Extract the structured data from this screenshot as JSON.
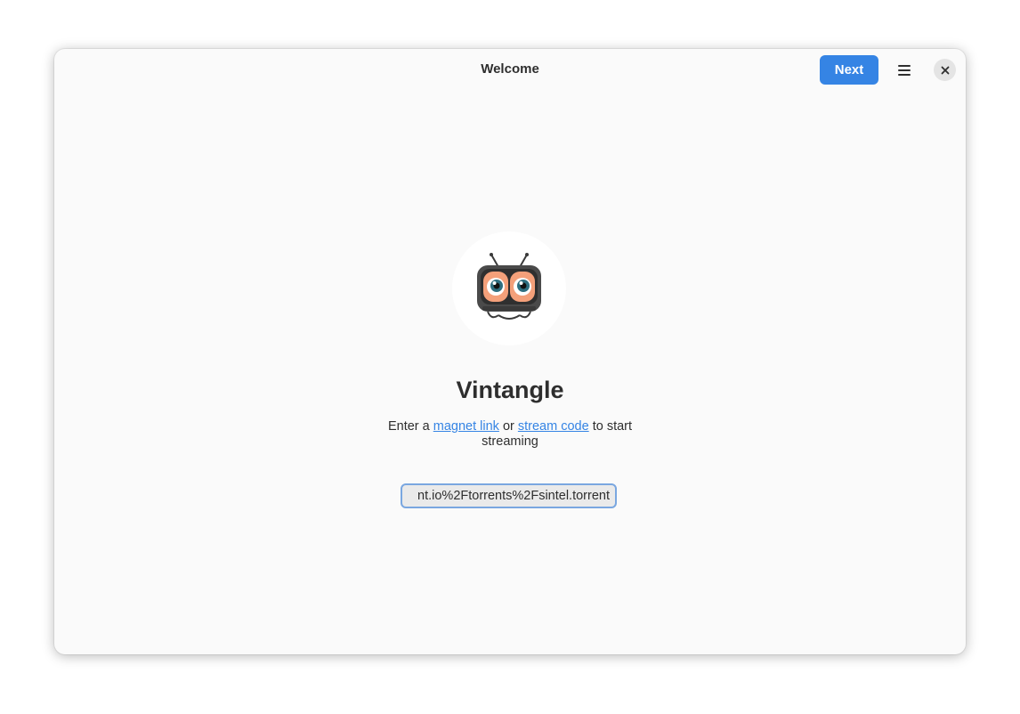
{
  "window": {
    "title": "Welcome"
  },
  "header": {
    "next_label": "Next",
    "menu_icon": "hamburger-menu-icon",
    "close_icon": "close-icon"
  },
  "main": {
    "logo": "tv-mascot-logo",
    "app_name": "Vintangle",
    "description": {
      "prefix": "Enter a",
      "link1": "magnet link",
      "middle": "or",
      "link2": "stream code",
      "suffix": "to start streaming"
    },
    "entry": {
      "value": "nt.io%2Ftorrents%2Fsintel.torrent"
    }
  },
  "colors": {
    "accent": "#3584e4",
    "window_bg": "#fafafa"
  }
}
